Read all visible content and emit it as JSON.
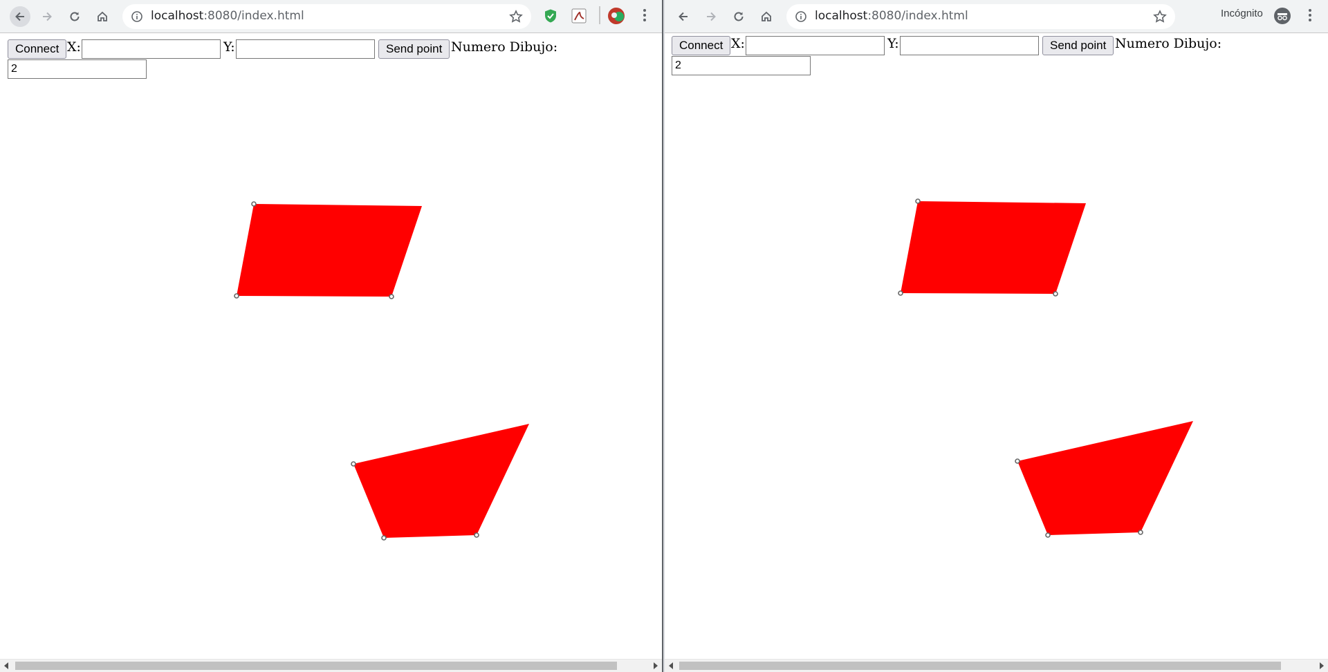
{
  "browser": {
    "url_host": "localhost",
    "url_rest": ":8080/index.html",
    "incognito_label": "Incógnito"
  },
  "page": {
    "connect_label": "Connect",
    "x_label": "X:",
    "y_label": "Y:",
    "x_value": "",
    "y_value": "",
    "send_label": "Send point",
    "numero_label": "Numero Dibujo:",
    "numero_value": "2"
  },
  "drawing": {
    "fill_color": "#ff0000",
    "vertex_color": "#666666"
  }
}
